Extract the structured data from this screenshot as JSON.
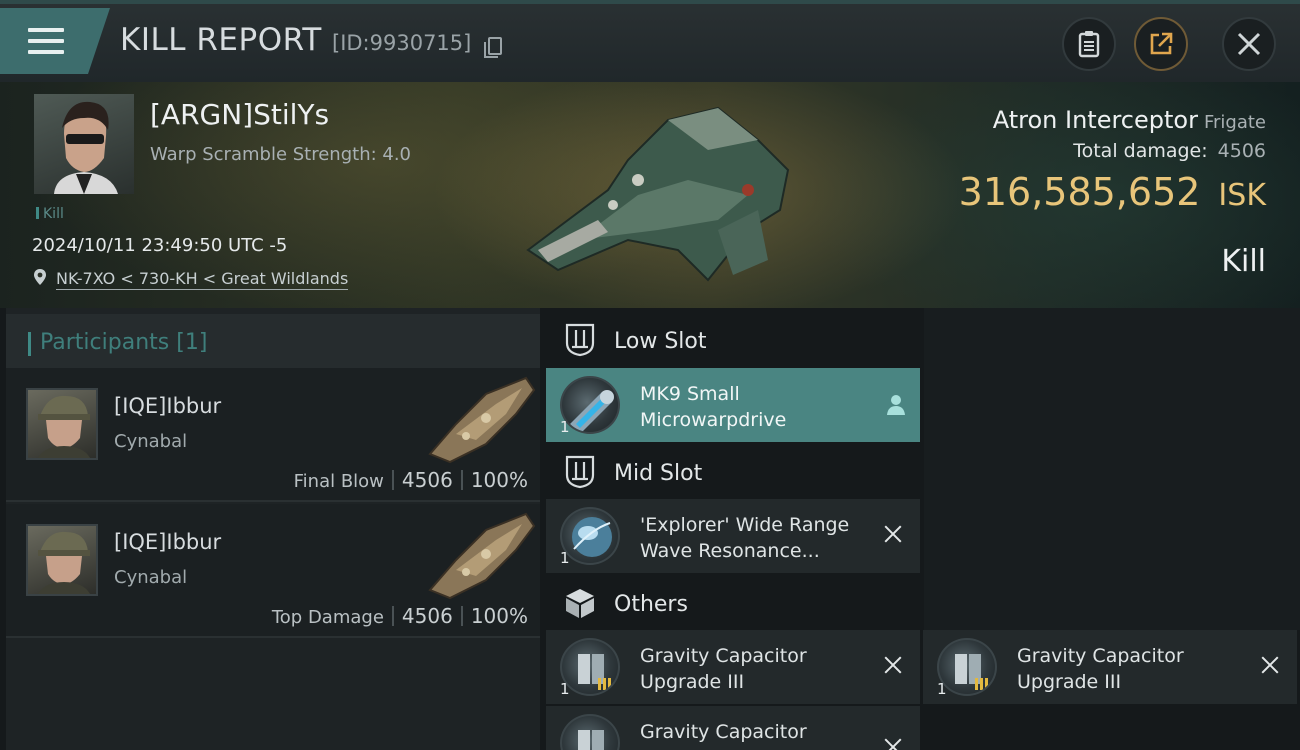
{
  "header": {
    "title": "KILL REPORT",
    "report_id": "[ID:9930715]",
    "icons": [
      "menu-icon",
      "copy-icon",
      "clipboard-icon",
      "share-icon",
      "close-icon"
    ]
  },
  "victim": {
    "name": "[ARGN]StilYs",
    "subtitle": "Warp Scramble Strength: 4.0",
    "tag": "Kill",
    "timestamp": "2024/10/11 23:49:50 UTC -5",
    "location": "NK-7XO < 730-KH < Great Wildlands",
    "ship_name": "Atron Interceptor",
    "ship_class": "Frigate",
    "total_damage_label": "Total damage:",
    "total_damage": "4506",
    "isk_value": "316,585,652",
    "isk_unit": "ISK",
    "result": "Kill"
  },
  "participants": {
    "label": "Participants",
    "count": "[1]",
    "rows": [
      {
        "name": "[IQE]Ibbur",
        "ship": "Cynabal",
        "role": "Final Blow",
        "damage": "4506",
        "percent": "100%"
      },
      {
        "name": "[IQE]Ibbur",
        "ship": "Cynabal",
        "role": "Top Damage",
        "damage": "4506",
        "percent": "100%"
      }
    ]
  },
  "slots": {
    "low": {
      "label": "Low Slot",
      "items": [
        {
          "name_line1": "MK9 Small",
          "name_line2": "Microwarpdrive",
          "qty": "1"
        }
      ]
    },
    "mid": {
      "label": "Mid Slot",
      "items": [
        {
          "name_line1": "'Explorer' Wide Range",
          "name_line2": "Wave Resonance...",
          "qty": "1"
        }
      ]
    },
    "others": {
      "label": "Others",
      "items": [
        {
          "name_line1": "Gravity Capacitor",
          "name_line2": "Upgrade III",
          "qty": "1"
        },
        {
          "name_line1": "Gravity Capacitor",
          "name_line2": "Upgrade III",
          "qty": "1"
        },
        {
          "name_line1": "Gravity Capacitor",
          "name_line2": "",
          "qty": ""
        }
      ]
    }
  },
  "colors": {
    "accent": "#3f8a86",
    "isk": "#e8c57a",
    "highlight": "#4a8582"
  }
}
